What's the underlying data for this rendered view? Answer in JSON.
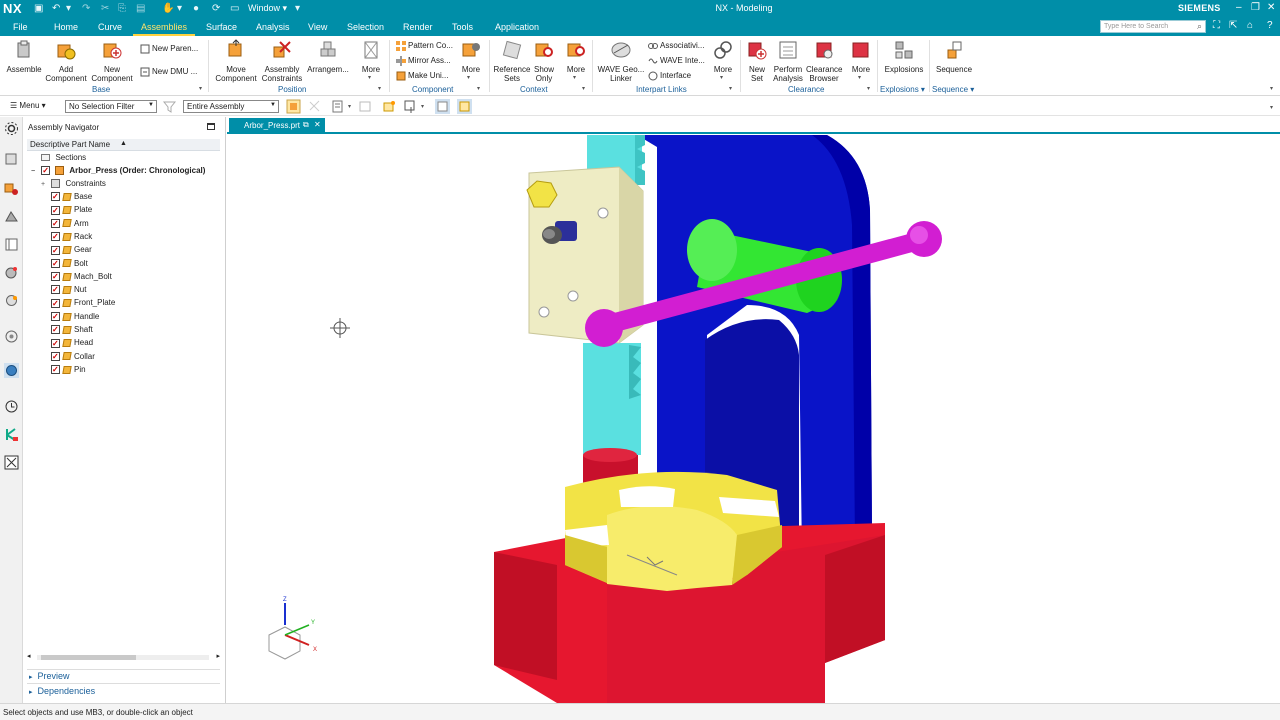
{
  "titlebar": {
    "logo": "NX",
    "window_menu": "Window",
    "title": "NX - Modeling",
    "brand": "SIEMENS",
    "minimize": "–",
    "restore": "❐",
    "close": "✕"
  },
  "tabs": [
    {
      "label": "File"
    },
    {
      "label": "Home"
    },
    {
      "label": "Curve"
    },
    {
      "label": "Assemblies",
      "active": true
    },
    {
      "label": "Surface"
    },
    {
      "label": "Analysis"
    },
    {
      "label": "View"
    },
    {
      "label": "Selection"
    },
    {
      "label": "Render"
    },
    {
      "label": "Tools"
    },
    {
      "label": "Application"
    }
  ],
  "search": {
    "placeholder": "Type Here to Search"
  },
  "ribbon": {
    "assemble": "Assemble",
    "add_component": "Add Component",
    "new_component": "New Component",
    "new_parent": "New Paren...",
    "new_dmu": "New DMU ...",
    "base_group": "Base",
    "move_component": "Move Component",
    "assembly_constraints": "Assembly Constraints",
    "arrangements": "Arrangem...",
    "more1": "More",
    "position_group": "Position",
    "pattern_component": "Pattern Co...",
    "mirror_assembly": "Mirror Ass...",
    "make_unique": "Make Uni...",
    "more2": "More",
    "component_group": "Component",
    "reference_sets": "Reference Sets",
    "show_only": "Show Only",
    "more3": "More",
    "context_group": "Context",
    "wave_geometry_linker": "WAVE Geo... Linker",
    "associativity": "Associativi...",
    "wave_interface": "WAVE Inte...",
    "interface": "Interface",
    "more4": "More",
    "interpart_group": "Interpart Links",
    "new_set": "New Set",
    "perform_analysis": "Perform Analysis",
    "clearance_browser": "Clearance Browser",
    "more5": "More",
    "clearance_group": "Clearance",
    "explosions": "Explosions",
    "explosions_group": "Explosions",
    "sequence": "Sequence",
    "sequence_group": "Sequence"
  },
  "selbar": {
    "menu": "Menu",
    "filter": "No Selection Filter",
    "scope": "Entire Assembly"
  },
  "navigator": {
    "title": "Assembly Navigator",
    "column": "Descriptive Part Name",
    "sections": "Sections",
    "root": "Arbor_Press (Order: Chronological)",
    "constraints": "Constraints",
    "parts": [
      "Base",
      "Plate",
      "Arm",
      "Rack",
      "Gear",
      "Bolt",
      "Mach_Bolt",
      "Nut",
      "Front_Plate",
      "Handle",
      "Shaft",
      "Head",
      "Collar",
      "Pin"
    ],
    "preview": "Preview",
    "dependencies": "Dependencies"
  },
  "document": {
    "tab": "Arbor_Press.prt"
  },
  "axis": {
    "z": "Z",
    "y": "Y",
    "x": "X"
  },
  "status": {
    "message": "Select objects and use MB3, or double-click an object"
  },
  "colors": {
    "chrome": "#008ea8",
    "active_tab": "#ffd23f",
    "link": "#1a5f99",
    "frame_blue": "#0a14c8",
    "base_red": "#e6172f",
    "gear_yellow": "#f2e346",
    "handle_magenta": "#d21ed2",
    "shaft_green": "#33e633",
    "rack_cyan": "#5ae0e0",
    "plate_cream": "#eeecc4"
  }
}
